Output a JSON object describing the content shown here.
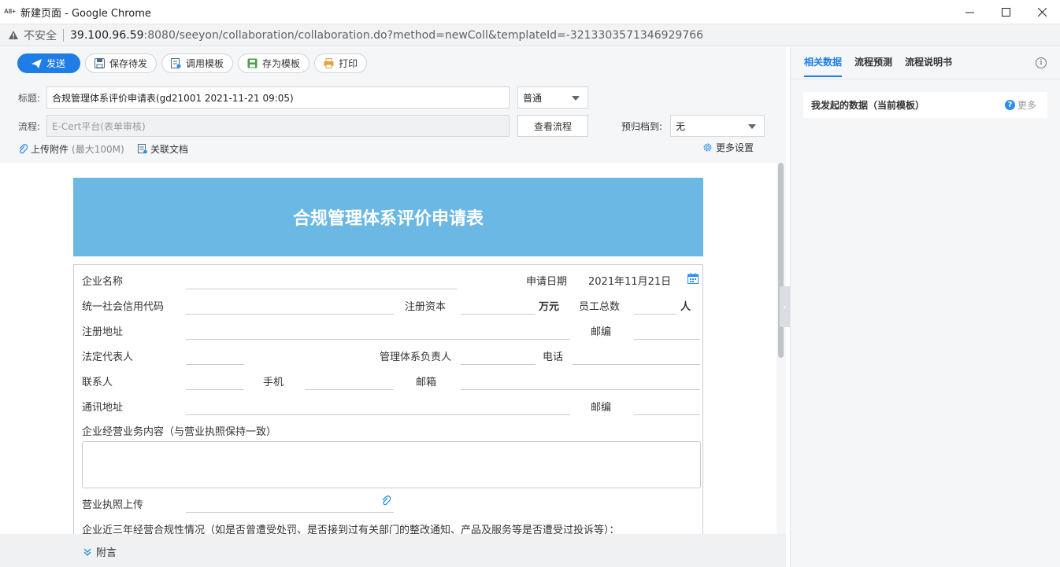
{
  "window": {
    "title": "新建页面 - Google Chrome",
    "app_icon_text": "A8+",
    "controls": [
      "minimize-icon",
      "maximize-icon",
      "close-icon"
    ]
  },
  "address_bar": {
    "security_label": "不安全",
    "url_host": "39.100.96.59",
    "url_rest": ":8080/seeyon/collaboration/collaboration.do?method=newColl&templateId=-3213303571346929766"
  },
  "toolbar": {
    "send": "发送",
    "save_draft": "保存待发",
    "use_template": "调用模板",
    "save_template": "存为模板",
    "print": "打印"
  },
  "header_form": {
    "title_label": "标题:",
    "title_value": "合规管理体系评价申请表(gd21001 2021-11-21 09:05)",
    "priority": "普通",
    "flow_label": "流程:",
    "flow_placeholder": "E-Cert平台(表单审核)",
    "view_flow": "查看流程",
    "archive_label": "预归档到:",
    "archive_value": "无",
    "attach_label": "上传附件",
    "attach_limit": "(最大100M)",
    "related_doc": "关联文档",
    "more_settings": "更多设置"
  },
  "form": {
    "banner_title": "合规管理体系评价申请表",
    "company_name": "企业名称",
    "apply_date_label": "申请日期",
    "apply_date_value": "2021年11月21日",
    "credit_code": "统一社会信用代码",
    "registered_capital": "注册资本",
    "capital_unit": "万元",
    "employee_total": "员工总数",
    "person_unit": "人",
    "registered_address": "注册地址",
    "postcode_1": "邮编",
    "legal_rep": "法定代表人",
    "system_head": "管理体系负责人",
    "phone": "电话",
    "contact": "联系人",
    "mobile": "手机",
    "email": "邮箱",
    "mailing_address": "通讯地址",
    "postcode_2": "邮编",
    "business_scope": "企业经营业务内容（与营业执照保持一致）",
    "license_upload": "营业执照上传",
    "compliance_history": "企业近三年经营合规性情况（如是否曾遭受处罚、是否接到过有关部门的整改通知、产品及服务等是否遭受过投诉等）："
  },
  "footer": {
    "note_label": "附言"
  },
  "side_panel": {
    "tabs": [
      "相关数据",
      "流程预测",
      "流程说明书"
    ],
    "active_tab": 0,
    "card_title": "我发起的数据（当前模板）",
    "more": "更多"
  },
  "colors": {
    "accent": "#1e7ee6",
    "banner": "#6ab8e3"
  }
}
